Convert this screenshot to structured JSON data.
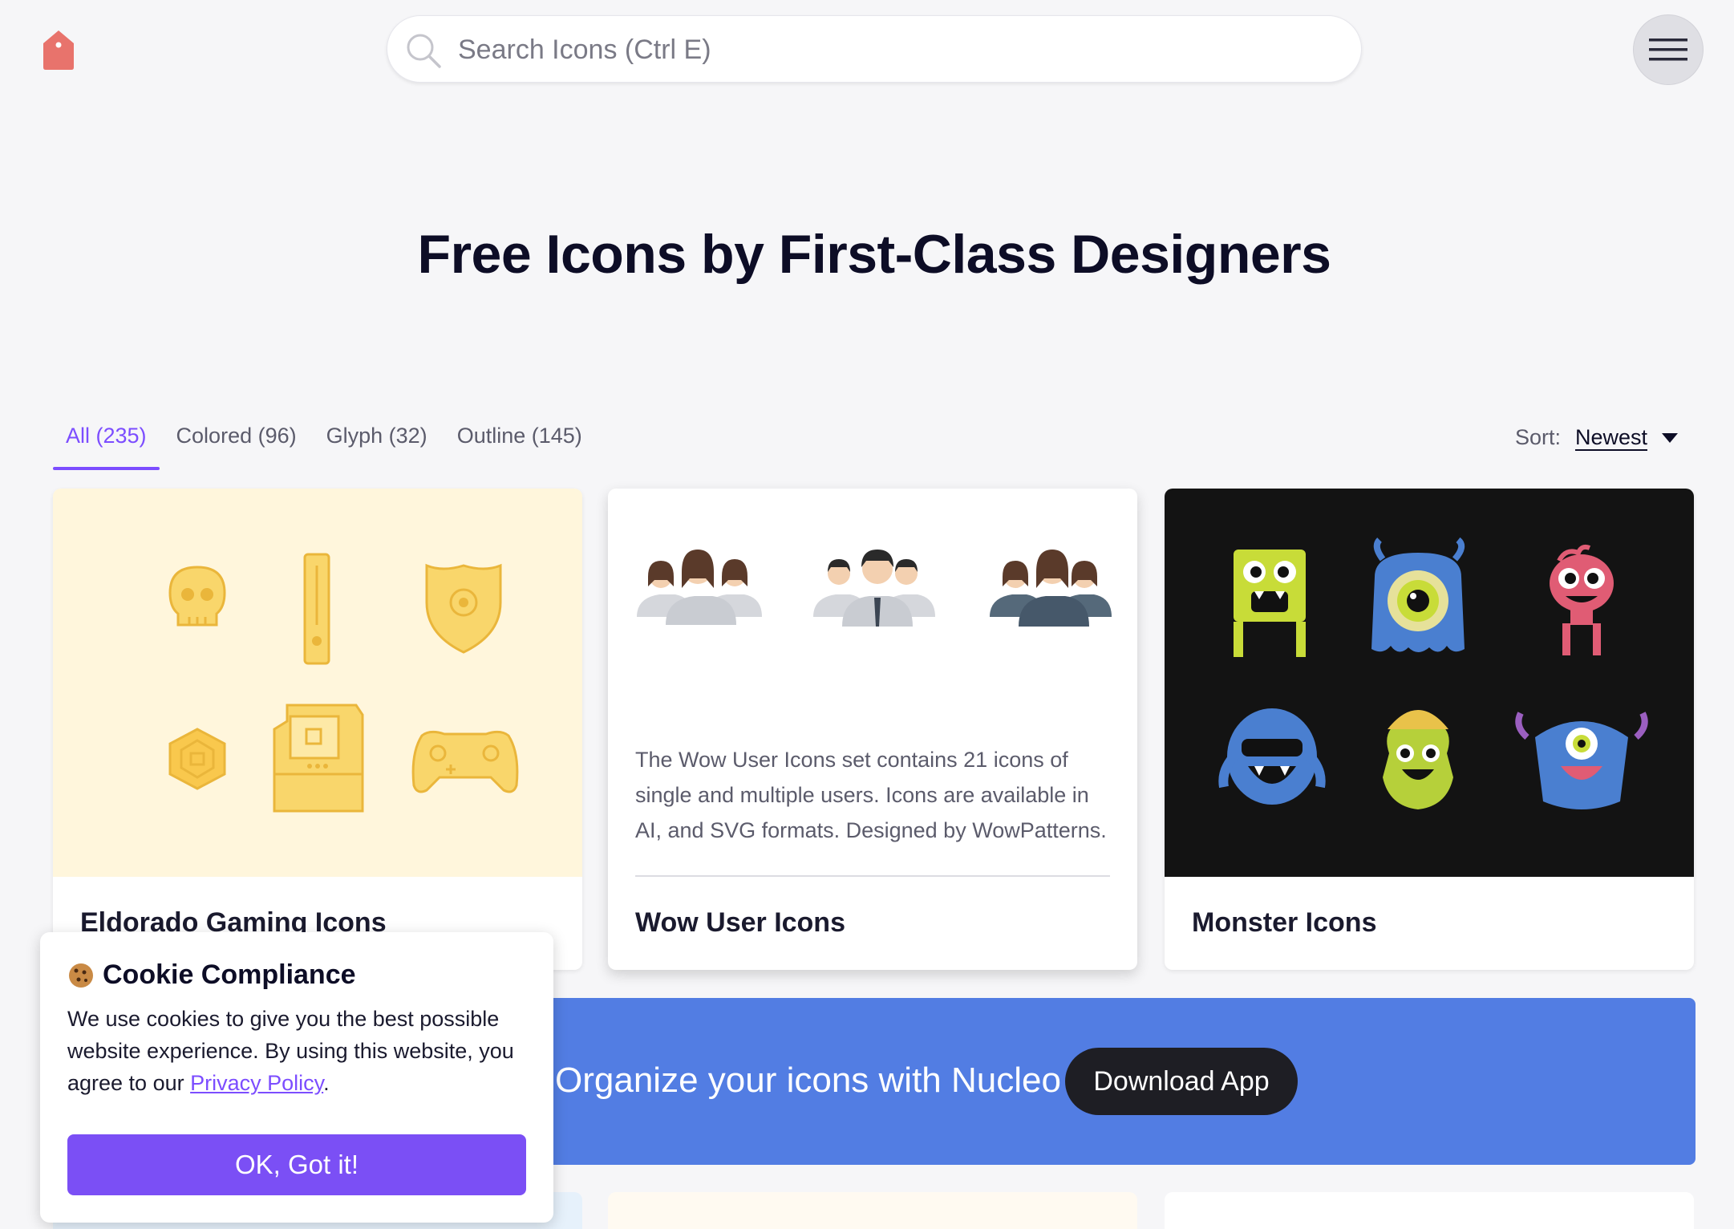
{
  "header": {
    "search_placeholder": "Search Icons (Ctrl E)"
  },
  "hero": {
    "title": "Free Icons by First-Class Designers"
  },
  "tabs": [
    {
      "label": "All (235)",
      "active": true
    },
    {
      "label": "Colored (96)",
      "active": false
    },
    {
      "label": "Glyph (32)",
      "active": false
    },
    {
      "label": "Outline (145)",
      "active": false
    }
  ],
  "sort": {
    "label": "Sort:",
    "value": "Newest"
  },
  "cards": [
    {
      "title": "Eldorado Gaming Icons",
      "icons": [
        "skull-icon",
        "console-icon",
        "shield-icon",
        "coin-icon",
        "arcade-machine-icon",
        "gamepad-icon"
      ]
    },
    {
      "title": "Wow User Icons",
      "description": "The Wow User Icons set contains 21 icons of single and multiple users. Icons are available in AI, and SVG formats. Designed by WowPatterns.",
      "icons": [
        "women-group-icon",
        "men-group-icon",
        "mixed-group-icon"
      ]
    },
    {
      "title": "Monster Icons",
      "icons": [
        "green-monster-icon",
        "blue-cyclops-icon",
        "pink-monster-icon",
        "sunglasses-monster-icon",
        "helmet-monster-icon",
        "horned-monster-icon"
      ]
    }
  ],
  "banner": {
    "text": "Organize your icons with Nucleo",
    "button": "Download App"
  },
  "cookie": {
    "title": "Cookie Compliance",
    "body_prefix": "We use cookies to give you the best possible website experience. By using this website, you agree to our ",
    "link": "Privacy Policy",
    "body_suffix": ".",
    "button": "OK, Got it!"
  },
  "colors": {
    "accent": "#7c4dff",
    "logo": "#e8736c",
    "banner": "#527de3",
    "gaming_bg": "#fff6dc",
    "monster_bg": "#131313"
  }
}
